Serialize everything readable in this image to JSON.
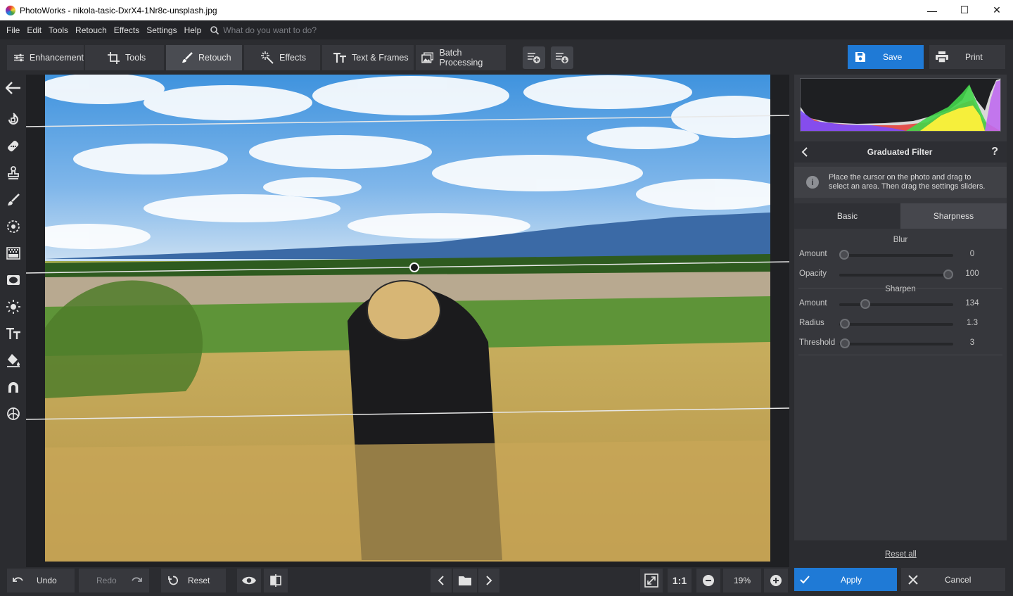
{
  "window": {
    "title": "PhotoWorks - nikola-tasic-DxrX4-1Nr8c-unsplash.jpg",
    "minimize": "—",
    "maximize": "☐",
    "close": "✕"
  },
  "menu": {
    "items": [
      "File",
      "Edit",
      "Tools",
      "Retouch",
      "Effects",
      "Settings",
      "Help"
    ],
    "search_placeholder": "What do you want to do?"
  },
  "toolbar": {
    "tabs": [
      {
        "label": "Enhancement",
        "icon": "sliders-icon"
      },
      {
        "label": "Tools",
        "icon": "crop-icon"
      },
      {
        "label": "Retouch",
        "icon": "brush-icon",
        "active": true
      },
      {
        "label": "Effects",
        "icon": "magic-wand-icon"
      },
      {
        "label": "Text & Frames",
        "icon": "text-icon"
      },
      {
        "label": "Batch Processing",
        "icon": "images-icon"
      }
    ],
    "save": "Save",
    "print": "Print"
  },
  "panel": {
    "title": "Graduated Filter",
    "help": "?",
    "info_line1": "Place the cursor on the photo and drag to",
    "info_line2": "select an area. Then drag the settings sliders.",
    "tab_basic": "Basic",
    "tab_sharpness": "Sharpness",
    "blur_section": "Blur",
    "sharpen_section": "Sharpen",
    "blur": [
      {
        "label": "Amount",
        "value": "0",
        "fraction": 0.0
      },
      {
        "label": "Opacity",
        "value": "100",
        "fraction": 1.0
      }
    ],
    "sharpen": [
      {
        "label": "Amount",
        "value": "134",
        "fraction": 0.2
      },
      {
        "label": "Radius",
        "value": "1.3",
        "fraction": 0.01
      },
      {
        "label": "Threshold",
        "value": "3",
        "fraction": 0.01
      }
    ],
    "reset_all": "Reset all",
    "apply": "Apply",
    "cancel": "Cancel"
  },
  "bottom": {
    "undo": "Undo",
    "redo": "Redo",
    "reset": "Reset",
    "fit_label": "1:1",
    "zoom": "19%"
  },
  "colors": {
    "accent": "#1f7ad6",
    "bg": "#2b2c30",
    "panel": "#36373c"
  }
}
